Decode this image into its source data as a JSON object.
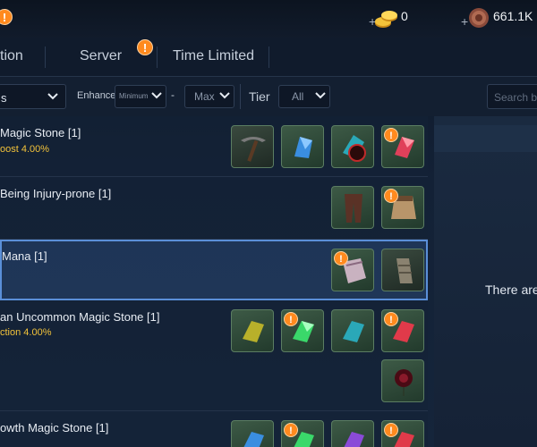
{
  "topbar": {
    "currency1_plus": "+",
    "currency1_amount": "0",
    "currency2_plus": "+",
    "currency2_amount": "661.1K",
    "top_alert": "!"
  },
  "tabs": [
    {
      "label": "tion"
    },
    {
      "label": "Server",
      "alert": "!"
    },
    {
      "label": "Time Limited"
    }
  ],
  "filters": {
    "category_value": "s",
    "enhance_label": "Enhance",
    "min_value": "Minimum",
    "dash": "-",
    "max_value": "Max",
    "tier_label": "Tier",
    "tier_value": "All",
    "search_placeholder": "Search by"
  },
  "list": [
    {
      "title": "Magic Stone [1]",
      "sub": "oost 4.00%"
    },
    {
      "title": "Being Injury-prone [1]",
      "sub": ""
    },
    {
      "title": "Mana [1]",
      "sub": ""
    },
    {
      "title": "an Uncommon Magic Stone [1]",
      "sub": "ction 4.00%"
    },
    {
      "title": "owth Magic Stone [1]",
      "sub": ""
    }
  ],
  "right_panel": {
    "empty_text": "There are"
  }
}
